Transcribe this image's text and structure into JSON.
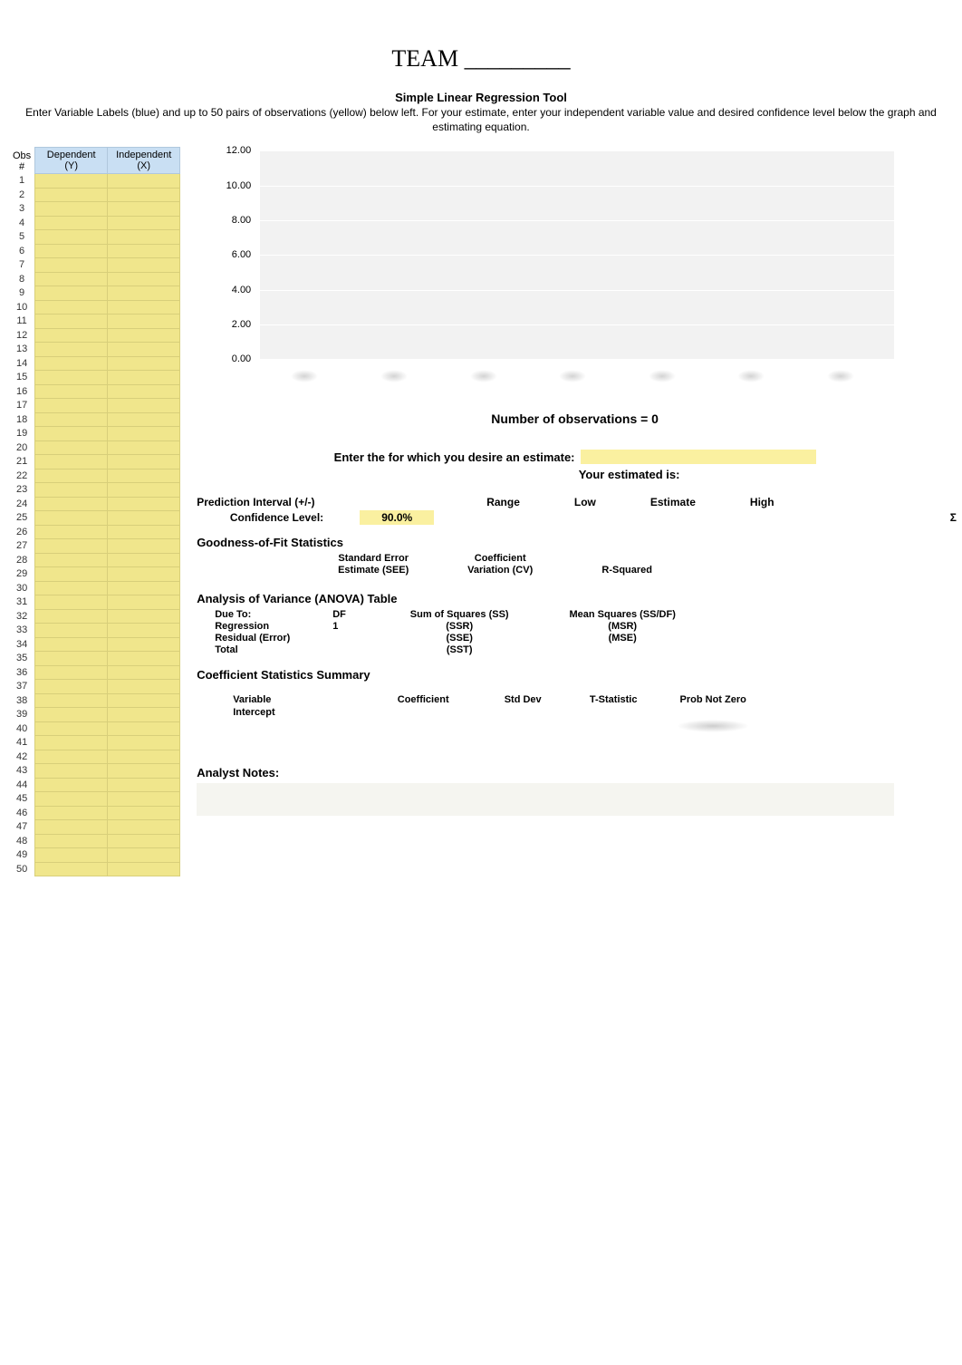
{
  "team_title": "TEAM _________",
  "tool_title": "Simple Linear Regression Tool",
  "tool_subtitle": "Enter Variable Labels (blue) and up to 50 pairs of observations (yellow) below left.  For your estimate, enter your independent variable value and desired confidence level below the graph and estimating equation.",
  "obs_header": {
    "obs_num_line1": "Obs",
    "obs_num_line2": "#",
    "dependent": "Dependent (Y)",
    "independent": "Independent (X)"
  },
  "obs_rows": [
    "1",
    "2",
    "3",
    "4",
    "5",
    "6",
    "7",
    "8",
    "9",
    "10",
    "11",
    "12",
    "13",
    "14",
    "15",
    "16",
    "17",
    "18",
    "19",
    "20",
    "21",
    "22",
    "23",
    "24",
    "25",
    "26",
    "27",
    "28",
    "29",
    "30",
    "31",
    "32",
    "33",
    "34",
    "35",
    "36",
    "37",
    "38",
    "39",
    "40",
    "41",
    "42",
    "43",
    "44",
    "45",
    "46",
    "47",
    "48",
    "49",
    "50"
  ],
  "chart_data": {
    "type": "line",
    "y_ticks": [
      "12.00",
      "10.00",
      "8.00",
      "6.00",
      "4.00",
      "2.00",
      "0.00"
    ],
    "ylim": [
      0,
      12
    ],
    "series": [],
    "title": "",
    "xlabel": "",
    "ylabel": ""
  },
  "num_observations": "Number of observations = 0",
  "enter_text": "Enter the  for which you desire an estimate:",
  "your_estimated": "Your estimated  is:",
  "prediction": {
    "label": "Prediction Interval (+/-)",
    "cols": [
      "Range",
      "Low",
      "Estimate",
      "High"
    ],
    "conf_label": "Confidence Level:",
    "conf_value": "90.0%",
    "sigma": "Σ"
  },
  "gof": {
    "title": "Goodness-of-Fit Statistics",
    "cols": [
      {
        "l1": "Standard Error",
        "l2": "Estimate (SEE)"
      },
      {
        "l1": "Coefficient",
        "l2": "Variation (CV)"
      },
      {
        "l1": "",
        "l2": "R-Squared"
      }
    ]
  },
  "anova": {
    "title": "Analysis of Variance (ANOVA) Table",
    "head": [
      "Due To:",
      "DF",
      "Sum of Squares (SS)",
      "Mean Squares (SS/DF)"
    ],
    "rows": [
      {
        "c1": "Regression",
        "c2": "1",
        "c3": "(SSR)",
        "c4": "(MSR)"
      },
      {
        "c1": "Residual (Error)",
        "c2": "",
        "c3": "(SSE)",
        "c4": "(MSE)"
      },
      {
        "c1": "Total",
        "c2": "",
        "c3": "(SST)",
        "c4": ""
      }
    ]
  },
  "coef": {
    "title": "Coefficient Statistics Summary",
    "head": [
      "Variable",
      "Coefficient",
      "Std Dev",
      "T-Statistic",
      "Prob Not Zero"
    ],
    "rows": [
      {
        "c1": "Intercept"
      }
    ]
  },
  "analyst_notes": "Analyst Notes:"
}
